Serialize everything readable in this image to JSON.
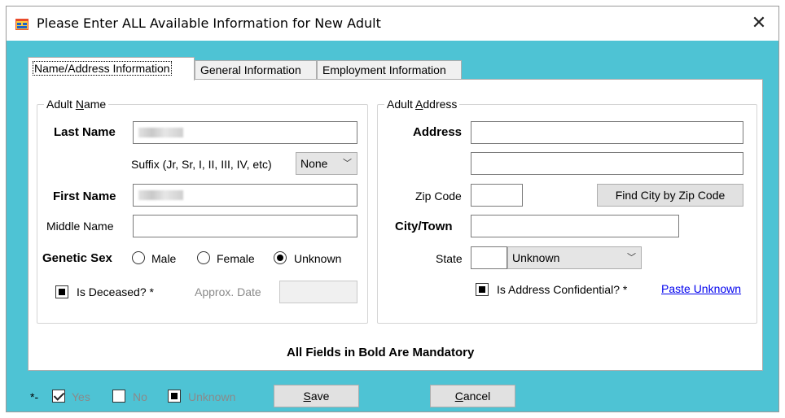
{
  "window": {
    "title": "Please Enter ALL Available Information for New Adult",
    "close_glyph": "✕"
  },
  "tabs": [
    {
      "label": "Name/Address Information",
      "active": true
    },
    {
      "label": "General Information",
      "active": false
    },
    {
      "label": "Employment Information",
      "active": false
    }
  ],
  "adult_name": {
    "group_title_prefix": "Adult ",
    "group_title_underlined": "N",
    "group_title_suffix": "ame",
    "last_name_label": "Last Name",
    "suffix_label": "Suffix (Jr, Sr, I, II, III, IV, etc)",
    "suffix_value": "None",
    "first_name_label": "First Name",
    "middle_name_label": "Middle Name",
    "middle_name_value": "",
    "genetic_sex_label": "Genetic Sex",
    "sex_options": [
      "Male",
      "Female",
      "Unknown"
    ],
    "sex_selected": "Unknown",
    "deceased_label": "Is Deceased? *",
    "approx_date_label": "Approx. Date",
    "approx_date_value": ""
  },
  "adult_address": {
    "group_title_prefix": "Adult ",
    "group_title_underlined": "A",
    "group_title_suffix": "ddress",
    "address_label": "Address",
    "address_line1": "",
    "address_line2": "",
    "zip_label": "Zip Code",
    "zip_value": "",
    "find_city_button": "Find City by Zip Code",
    "city_label": "City/Town",
    "city_value": "",
    "state_label": "State",
    "state_code": "",
    "state_value": "Unknown",
    "confidential_label": "Is Address Confidential? *",
    "paste_unknown_link": "Paste Unknown"
  },
  "mandatory_note": "All Fields in Bold Are Mandatory",
  "legend": {
    "prefix": "*-",
    "yes": "Yes",
    "no": "No",
    "unknown": "Unknown"
  },
  "buttons": {
    "save_underlined": "S",
    "save_rest": "ave",
    "cancel_underlined": "C",
    "cancel_rest": "ancel"
  },
  "icons": {
    "app": "form-app-icon",
    "close": "close-icon",
    "dropdown": "chevron-down-icon"
  }
}
